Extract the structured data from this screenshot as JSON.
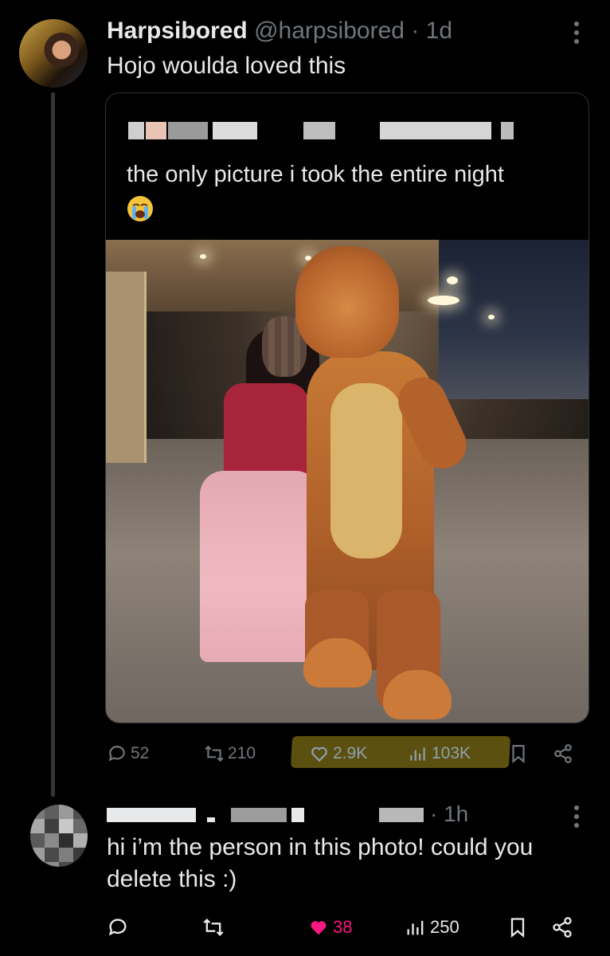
{
  "tweet": {
    "display_name": "Harpsibored",
    "handle": "@harpsibored",
    "separator": "·",
    "time": "1d",
    "text": "Hojo woulda loved this"
  },
  "quote": {
    "text": "the only picture i took the entire night",
    "emoji": "😭"
  },
  "tweet_actions": {
    "replies": "52",
    "reposts": "210",
    "likes": "2.9K",
    "views": "103K"
  },
  "reply": {
    "separator": "·",
    "time": "1h",
    "text": "hi i’m the person in this photo! could you delete this :)"
  },
  "reply_actions": {
    "likes": "38",
    "views": "250"
  },
  "colors": {
    "background": "#000000",
    "text": "#e7e9ea",
    "muted": "#71767b",
    "like_pink": "#f91880",
    "highlight": "#6b5e12"
  },
  "icons": [
    "more-icon",
    "reply-icon",
    "repost-icon",
    "like-icon",
    "views-icon",
    "bookmark-icon",
    "share-icon"
  ]
}
